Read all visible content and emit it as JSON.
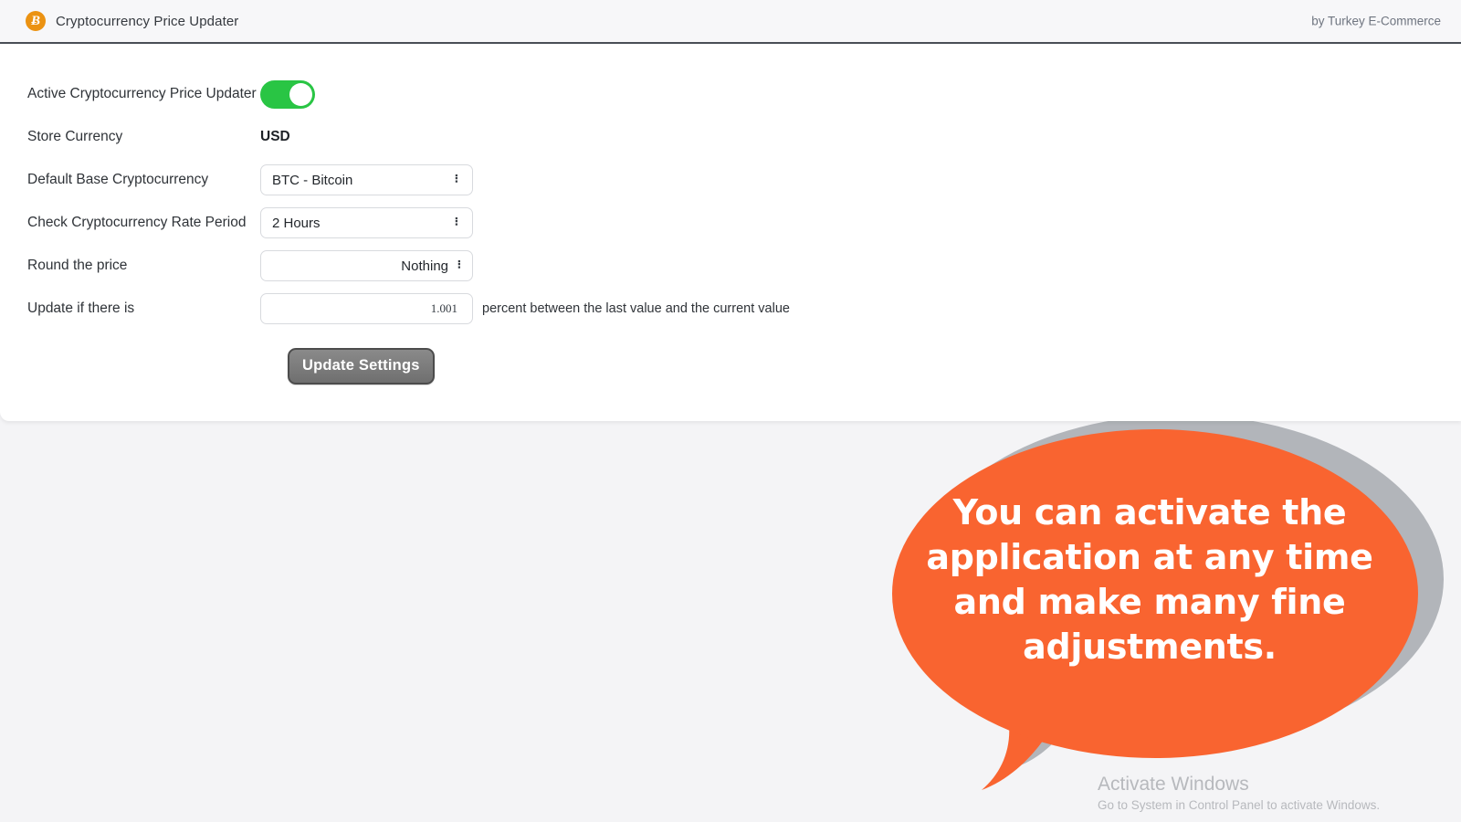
{
  "header": {
    "icon": "bitcoin-icon",
    "icon_glyph": "Ƀ",
    "title": "Cryptocurrency Price Updater",
    "credit": "by Turkey E-Commerce",
    "accent_color": "#eb9212",
    "border_color": "#4a4f57"
  },
  "form": {
    "rows": {
      "active": {
        "label": "Active Cryptocurrency Price Updater",
        "toggle_state": "on",
        "toggle_color": "#29c544"
      },
      "store_currency": {
        "label": "Store Currency",
        "value": "USD"
      },
      "base_crypto": {
        "label": "Default Base Cryptocurrency",
        "value": "BTC - Bitcoin",
        "options": [
          "BTC - Bitcoin"
        ]
      },
      "rate_period": {
        "label": "Check Cryptocurrency Rate Period",
        "value": "2 Hours",
        "options": [
          "2 Hours"
        ]
      },
      "round_price": {
        "label": "Round the price",
        "value": "Nothing",
        "options": [
          "Nothing"
        ]
      },
      "update_threshold": {
        "label": "Update if there is",
        "value": "1.001",
        "suffix": "percent between the last value and the current value"
      }
    },
    "submit_label": "Update Settings"
  },
  "callout": {
    "text": "You can activate the application at any time and make many fine adjustments.",
    "fill_color": "#f96430",
    "shadow_color": "#b2b5ba"
  },
  "watermark": {
    "title": "Activate Windows",
    "subtitle": "Go to System in Control Panel to activate Windows."
  }
}
